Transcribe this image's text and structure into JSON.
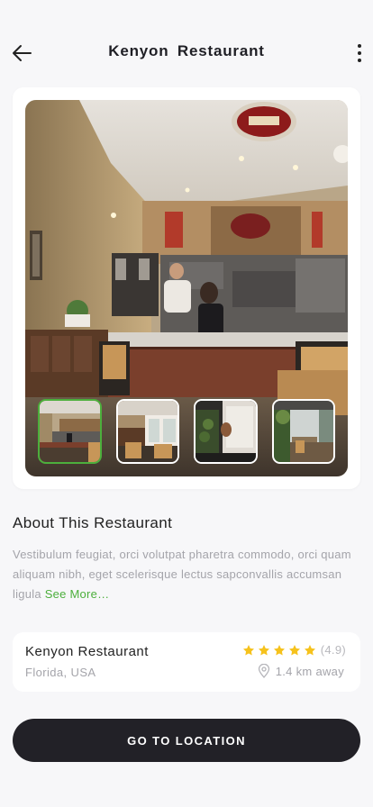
{
  "header": {
    "title": "Kenyon  Restaurant",
    "back_icon": "arrow-left-icon",
    "more_icon": "more-vertical-icon"
  },
  "gallery": {
    "main_image": "restaurant-counter-photo",
    "thumbnails": [
      {
        "image": "counter-thumbnail",
        "selected": true
      },
      {
        "image": "dining-room-thumbnail",
        "selected": false
      },
      {
        "image": "entrance-thumbnail",
        "selected": false
      },
      {
        "image": "terrace-thumbnail",
        "selected": false
      }
    ]
  },
  "about": {
    "title": "About This Restaurant",
    "description": "Vestibulum feugiat, orci volutpat pharetra commodo, orci quam aliquam nibh, eget scelerisque lectus  sapconvallis accumsan ligula",
    "see_more": "See More…"
  },
  "info": {
    "name": "Kenyon Restaurant",
    "location": "Florida, USA",
    "stars": 5,
    "rating": "(4.9)",
    "distance": "1.4 km away"
  },
  "cta": {
    "label": "GO TO LOCATION"
  },
  "colors": {
    "accent": "#4caf3c",
    "star": "#f6c21c",
    "button": "#222127",
    "background": "#f7f7f9"
  }
}
